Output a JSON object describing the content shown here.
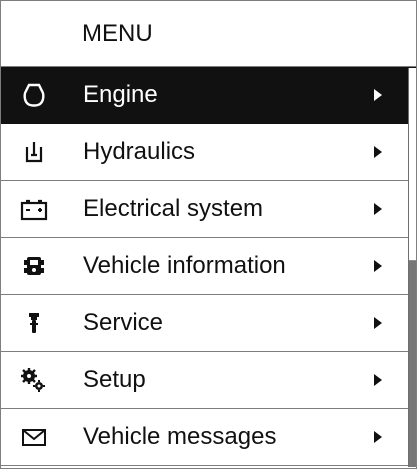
{
  "menu": {
    "title": "MENU",
    "selected_index": 0,
    "items": [
      {
        "label": "Engine",
        "icon": "engine-icon",
        "selected": true
      },
      {
        "label": "Hydraulics",
        "icon": "hydraulics-icon",
        "selected": false
      },
      {
        "label": "Electrical system",
        "icon": "battery-icon",
        "selected": false
      },
      {
        "label": "Vehicle information",
        "icon": "vehicle-info-icon",
        "selected": false
      },
      {
        "label": "Service",
        "icon": "service-tool-icon",
        "selected": false
      },
      {
        "label": "Setup",
        "icon": "gears-icon",
        "selected": false
      },
      {
        "label": "Vehicle messages",
        "icon": "envelope-icon",
        "selected": false
      }
    ]
  },
  "scrollbar": {
    "position_fraction": 0.0,
    "visible_fraction": 0.48
  },
  "colors": {
    "selected_background": "#111111",
    "selected_text": "#ffffff",
    "text": "#111111",
    "divider": "#7d7d7d",
    "scrollbar_track": "#777777"
  }
}
